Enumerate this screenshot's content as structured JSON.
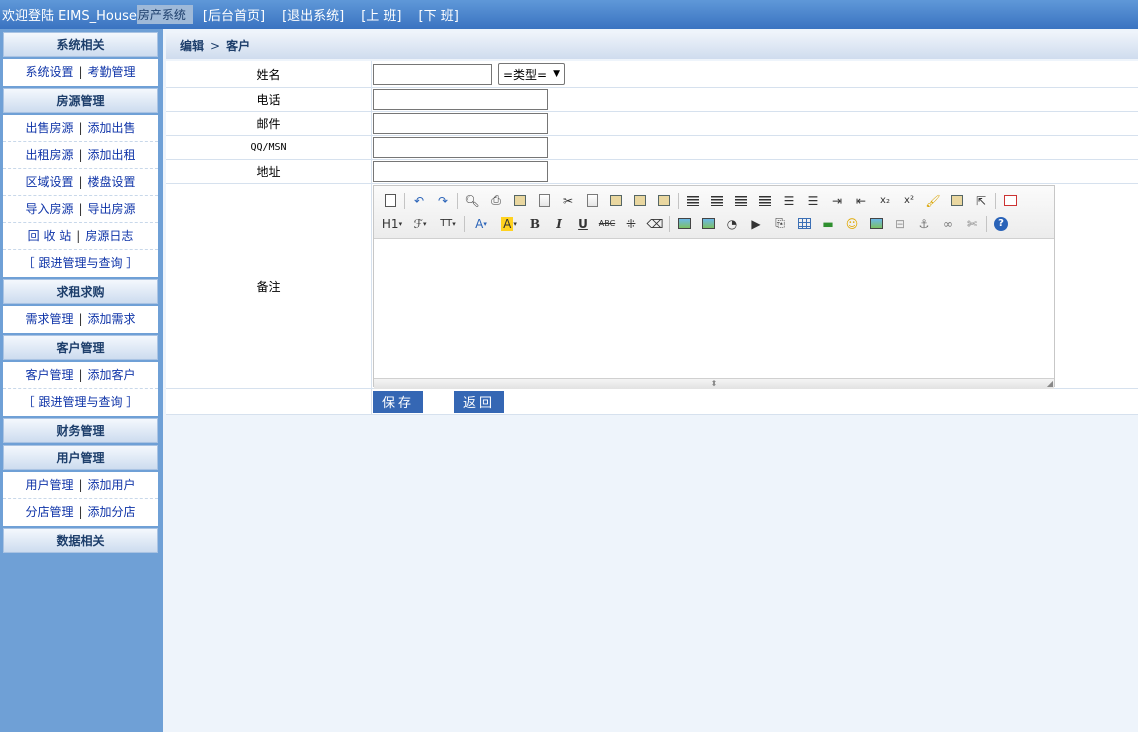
{
  "topbar": {
    "welcome": "欢迎登陆 EIMS_House",
    "system_name": "房产系统",
    "links": [
      "[后台首页]",
      "[退出系统]",
      "[上 班]",
      "[下 班]"
    ]
  },
  "sidebar": {
    "sections": [
      {
        "title": "系统相关",
        "rows": [
          {
            "links": [
              "系统设置",
              "考勤管理"
            ]
          }
        ]
      },
      {
        "title": "房源管理",
        "rows": [
          {
            "links": [
              "出售房源",
              "添加出售"
            ]
          },
          {
            "links": [
              "出租房源",
              "添加出租"
            ]
          },
          {
            "links": [
              "区域设置",
              "楼盘设置"
            ]
          },
          {
            "links": [
              "导入房源",
              "导出房源"
            ]
          },
          {
            "links": [
              "回 收 站",
              "房源日志"
            ]
          },
          {
            "single": "［ 跟进管理与查询 ］"
          }
        ]
      },
      {
        "title": "求租求购",
        "rows": [
          {
            "links": [
              "需求管理",
              "添加需求"
            ]
          }
        ]
      },
      {
        "title": "客户管理",
        "rows": [
          {
            "links": [
              "客户管理",
              "添加客户"
            ]
          },
          {
            "single": "［ 跟进管理与查询 ］"
          }
        ]
      },
      {
        "title": "财务管理",
        "rows": []
      },
      {
        "title": "用户管理",
        "rows": [
          {
            "links": [
              "用户管理",
              "添加用户"
            ]
          },
          {
            "links": [
              "分店管理",
              "添加分店"
            ]
          }
        ]
      },
      {
        "title": "数据相关",
        "rows": []
      }
    ]
  },
  "breadcrumb": {
    "part1": "编辑",
    "arrow": ">",
    "part2": "客户"
  },
  "form": {
    "name_label": "姓名",
    "name_value": "",
    "type_select": "=类型=",
    "phone_label": "电话",
    "phone_value": "",
    "email_label": "邮件",
    "email_value": "",
    "qq_label": "QQ/MSN",
    "qq_value": "",
    "address_label": "地址",
    "address_value": "",
    "notes_label": "备注",
    "notes_value": ""
  },
  "editor_toolbar": {
    "row1": [
      "source-icon",
      "undo-icon",
      "redo-icon",
      "preview-icon",
      "print-icon",
      "template-icon",
      "code-icon",
      "cut-icon",
      "copy-icon",
      "paste-icon",
      "paste-text-icon",
      "paste-word-icon",
      "align-left-icon",
      "align-center-icon",
      "align-right-icon",
      "align-justify-icon",
      "ordered-list-icon",
      "unordered-list-icon",
      "indent-icon",
      "outdent-icon",
      "subscript-icon",
      "superscript-icon",
      "clear-format-icon",
      "select-all-icon",
      "select-icon",
      "fullscreen-icon"
    ],
    "row2": [
      "heading-icon",
      "font-family-icon",
      "font-size-icon",
      "font-color-icon",
      "highlight-icon",
      "bold-icon",
      "italic-icon",
      "underline-icon",
      "strikethrough-icon",
      "line-height-icon",
      "remove-format-icon",
      "image-icon",
      "multi-image-icon",
      "flash-icon",
      "media-icon",
      "attachment-icon",
      "table-icon",
      "hr-icon",
      "emoticon-icon",
      "map-icon",
      "pagebreak-icon",
      "anchor-icon",
      "link-icon",
      "unlink-icon",
      "help-icon"
    ],
    "labels": {
      "heading": "H1",
      "font_size": "TT",
      "font_color": "A",
      "highlight": "A",
      "bold": "B",
      "italic": "I",
      "underline": "U",
      "strike": "ABC",
      "superscript": "x²",
      "subscript": "x₂",
      "help": "?"
    }
  },
  "buttons": {
    "save": "保存",
    "back": "返回"
  },
  "colors": {
    "accent": "#3567b4",
    "topbar": "#4a84cc",
    "sidebar": "#6fa0d6",
    "link": "#0f34a8"
  }
}
